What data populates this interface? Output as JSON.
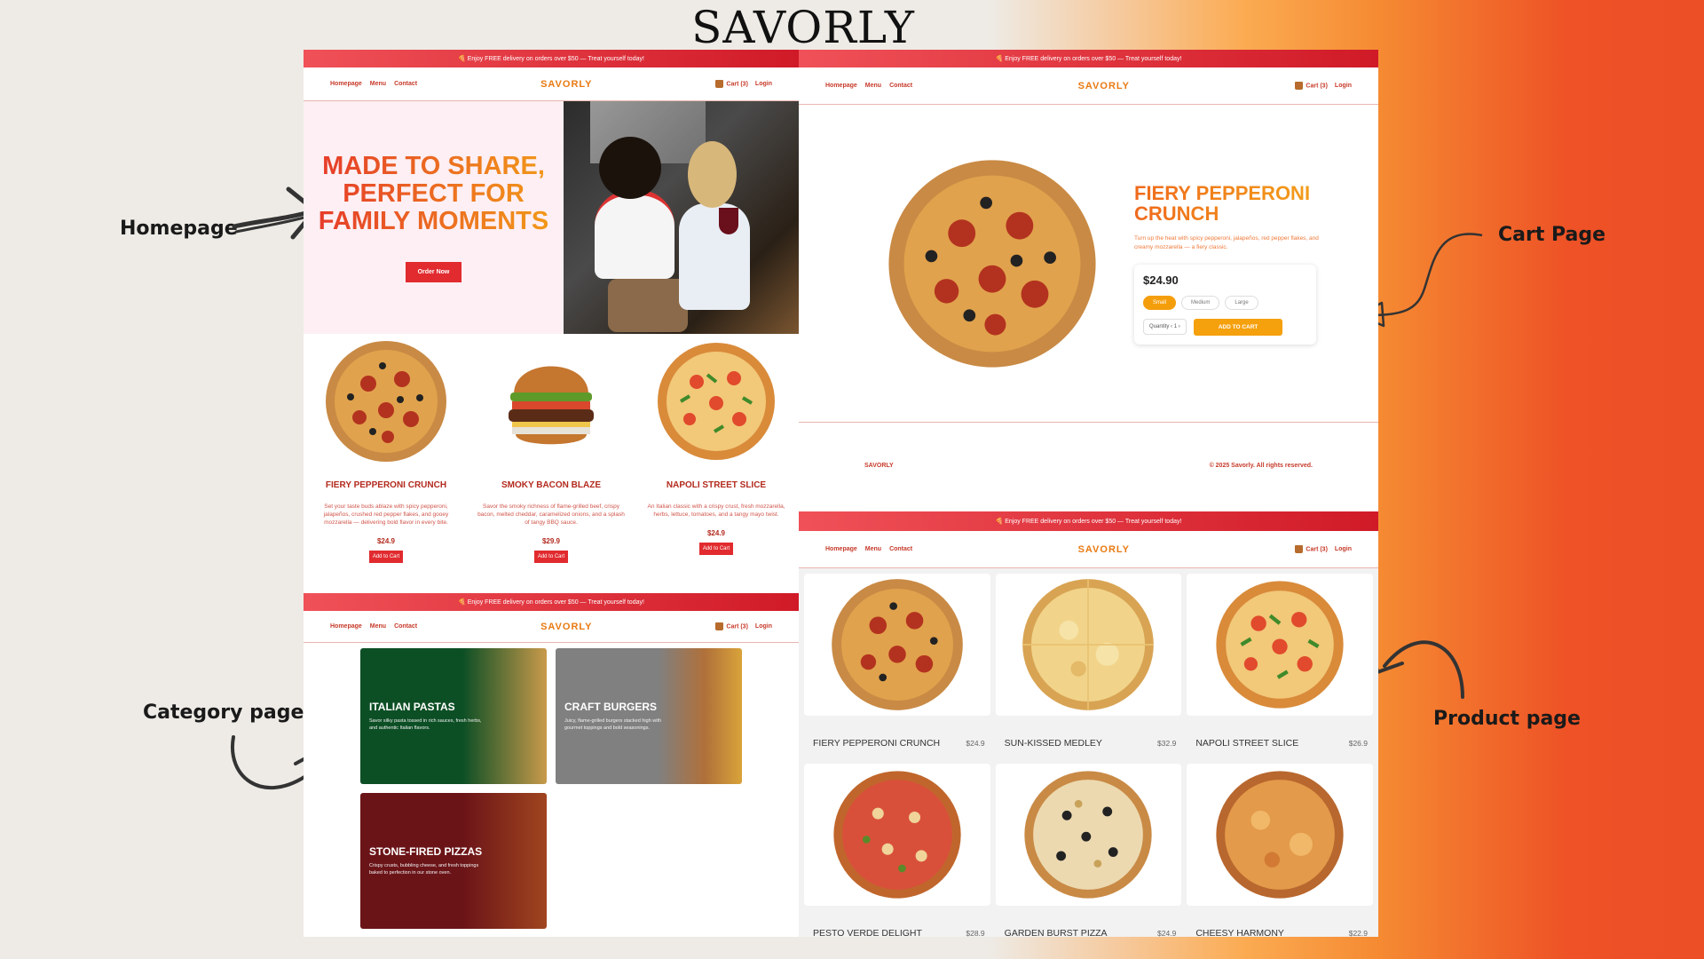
{
  "brand": "SAVORLY",
  "labels": {
    "homepage": "Homepage",
    "cart": "Cart Page",
    "category": "Category page",
    "product": "Product page"
  },
  "common": {
    "promo": "🍕 Enjoy FREE delivery on orders over $50 — Treat yourself today!",
    "nav": [
      "Homepage",
      "Menu",
      "Contact"
    ],
    "logo": "SAVORLY",
    "cart": "Cart (3)",
    "login": "Login"
  },
  "homepage": {
    "hero_title": "MADE TO SHARE, PERFECT FOR FAMILY MOMENTS",
    "order_button": "Order Now",
    "products": [
      {
        "name": "FIERY PEPPERONI CRUNCH",
        "desc": "Set your taste buds ablaze with spicy pepperoni, jalapeños, crushed red pepper flakes, and gooey mozzarella — delivering bold flavor in every bite.",
        "price": "$24.9",
        "button": "Add to Cart"
      },
      {
        "name": "SMOKY BACON BLAZE",
        "desc": "Savor the smoky richness of flame-grilled beef, crispy bacon, melted cheddar, caramelized onions, and a splash of tangy BBQ sauce.",
        "price": "$29.9",
        "button": "Add to Cart"
      },
      {
        "name": "NAPOLI STREET SLICE",
        "desc": "An Italian classic with a crispy crust, fresh mozzarella, herbs, lettuce, tomatoes, and a tangy mayo twist.",
        "price": "$24.9",
        "button": "Add to Cart"
      }
    ]
  },
  "cart_page": {
    "title": "FIERY PEPPERONI CRUNCH",
    "desc": "Turn up the heat with spicy pepperoni, jalapeños, red pepper flakes, and creamy mozzarella — a fiery classic.",
    "price": "$24.90",
    "sizes": [
      "Small",
      "Medium",
      "Large"
    ],
    "quantity_label": "Quantity",
    "quantity_value": "1",
    "add_button": "ADD TO CART",
    "footer_logo": "SAVORLY",
    "footer_copy": "© 2025 Savorly. All rights reserved."
  },
  "category_page": {
    "categories": [
      {
        "title": "ITALIAN PASTAS",
        "desc": "Savor silky pasta tossed in rich sauces, fresh herbs, and authentic Italian flavors."
      },
      {
        "title": "CRAFT BURGERS",
        "desc": "Juicy, flame-grilled burgers stacked high with gourmet toppings and bold seasonings."
      },
      {
        "title": "STONE-FIRED PIZZAS",
        "desc": "Crispy crusts, bubbling cheese, and fresh toppings baked to perfection in our stone oven."
      }
    ]
  },
  "product_page": {
    "items": [
      {
        "name": "FIERY PEPPERONI CRUNCH",
        "price": "$24.9"
      },
      {
        "name": "SUN-KISSED MEDLEY",
        "price": "$32.9"
      },
      {
        "name": "NAPOLI STREET SLICE",
        "price": "$26.9"
      },
      {
        "name": "PESTO VERDE DELIGHT",
        "price": "$28.9"
      },
      {
        "name": "GARDEN BURST PIZZA",
        "price": "$24.9"
      },
      {
        "name": "CHEESY HARMONY",
        "price": "$22.9"
      }
    ]
  }
}
